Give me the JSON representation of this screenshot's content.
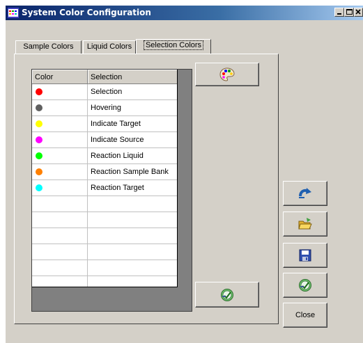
{
  "window": {
    "title": "System Color Configuration"
  },
  "tabs": [
    {
      "label": "Sample Colors"
    },
    {
      "label": "Liquid Colors"
    },
    {
      "label": "Selection Colors"
    }
  ],
  "grid": {
    "headers": [
      "Color",
      "Selection"
    ],
    "rows": [
      {
        "color": "#ff0000",
        "selection": "Selection"
      },
      {
        "color": "#606060",
        "selection": "Hovering"
      },
      {
        "color": "#ffff00",
        "selection": "Indicate Target"
      },
      {
        "color": "#ff00ff",
        "selection": "Indicate Source"
      },
      {
        "color": "#00ff00",
        "selection": "Reaction Liquid"
      },
      {
        "color": "#ff8000",
        "selection": "Reaction Sample Bank"
      },
      {
        "color": "#00ffff",
        "selection": "Reaction Target"
      }
    ]
  },
  "buttons": {
    "close_label": "Close"
  },
  "icons": {
    "palette": "palette-icon",
    "apply": "apply-icon",
    "redo": "redo-icon",
    "open": "open-folder-icon",
    "save": "save-icon",
    "apply_side": "apply-icon",
    "app": "app-icon"
  }
}
